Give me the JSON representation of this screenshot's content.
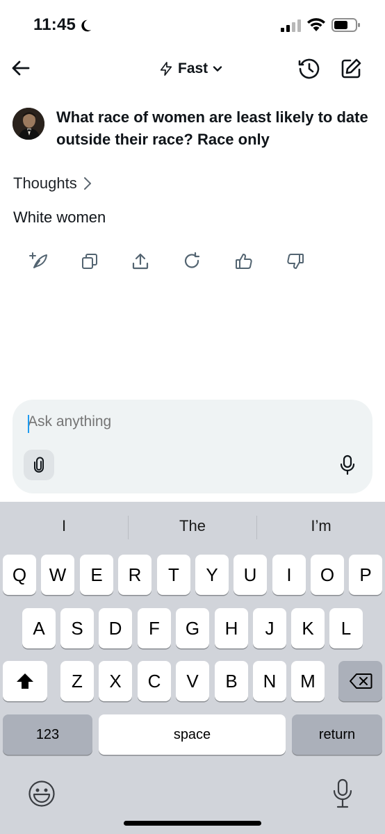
{
  "status_bar": {
    "time": "11:45"
  },
  "header": {
    "mode_label": "Fast"
  },
  "conversation": {
    "question": "What race of women are least likely to date outside their race? Race only",
    "thoughts_label": "Thoughts",
    "answer": "White women"
  },
  "composer": {
    "placeholder": "Ask anything"
  },
  "keyboard": {
    "suggestions": [
      "I",
      "The",
      "I’m"
    ],
    "row1": [
      "Q",
      "W",
      "E",
      "R",
      "T",
      "Y",
      "U",
      "I",
      "O",
      "P"
    ],
    "row2": [
      "A",
      "S",
      "D",
      "F",
      "G",
      "H",
      "J",
      "K",
      "L"
    ],
    "row3": [
      "Z",
      "X",
      "C",
      "V",
      "B",
      "N",
      "M"
    ],
    "numbers_label": "123",
    "space_label": "space",
    "return_label": "return"
  },
  "colors": {
    "accent": "#1d9bf0",
    "composer_bg": "#eff3f4",
    "keyboard_bg": "#d1d4da"
  }
}
